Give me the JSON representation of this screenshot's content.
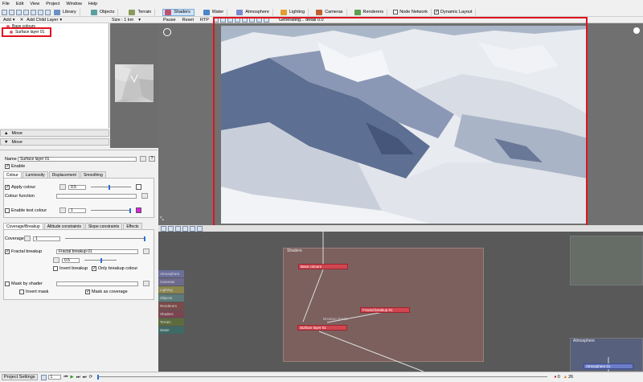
{
  "menu": [
    "File",
    "Edit",
    "View",
    "Project",
    "Window",
    "Help"
  ],
  "toolbar": {
    "buttons": [
      {
        "label": "Library",
        "color": "#6b8fc7"
      },
      {
        "label": "Objects",
        "color": "#5aa0a0"
      },
      {
        "label": "Terrain",
        "color": "#8a9a5a"
      },
      {
        "label": "Shaders",
        "color": "#c05070"
      },
      {
        "label": "Water",
        "color": "#4a86c8"
      },
      {
        "label": "Atmosphere",
        "color": "#7a8ad0"
      },
      {
        "label": "Lighting",
        "color": "#e0a030"
      },
      {
        "label": "Cameras",
        "color": "#c06030"
      },
      {
        "label": "Renderers",
        "color": "#5aa050"
      }
    ],
    "node_network": "Node Network",
    "dynamic_layout": "Dynamic Layout"
  },
  "tree": {
    "add_label": "Add",
    "add_child_label": "Add Child Layer",
    "items": [
      "Base colours",
      "Surface layer 01"
    ],
    "move_up": "Move",
    "move_down": "Move"
  },
  "thumb": {
    "size_label": "Size : 1 km"
  },
  "settings": {
    "name_label": "Name",
    "name_value": "Surface layer 01",
    "enable_label": "Enable",
    "tabs": [
      "Colour",
      "Luminosity",
      "Displacement",
      "Smoothing"
    ],
    "apply_colour": "Apply colour",
    "apply_value": "0.5",
    "colour_function": "Colour function",
    "enable_test_colour": "Enable test colour",
    "test_value": "1",
    "coverage_tabs": [
      "Coverage/Breakup",
      "Altitude constraints",
      "Slope constraints",
      "Effects"
    ],
    "coverage_label": "Coverage",
    "coverage_value": "1",
    "fractal_breakup": "Fractal breakup",
    "fractal_value": "Fractal breakup 01",
    "fractal_num": "0.5",
    "invert_breakup": "Invert breakup",
    "only_breakup_colour": "Only breakup colour",
    "mask_by_shader": "Mask by shader",
    "invert_mask": "Invert mask",
    "mask_as_coverage": "Mask as coverage",
    "colors": {
      "test_swatch": "#e020e0",
      "apply_swatch": "#ffffff"
    }
  },
  "viewport": {
    "pause": "Pause",
    "reset": "Reset",
    "rtp": "RTP",
    "status": "Generating... detail 0.0"
  },
  "network": {
    "shaders_title": "Shaders",
    "atmosphere_title": "Atmosphere",
    "nodes": {
      "base_colours": "Base colours",
      "fractal": "Fractal breakup 01",
      "surface": "Surface layer 01",
      "atmosphere": "Atmosphere 01",
      "edge_label": "Breakup shader"
    },
    "legend": [
      {
        "label": "Atmosphere",
        "color": "#6a6f9c"
      },
      {
        "label": "Cameras",
        "color": "#6d6a8e"
      },
      {
        "label": "Lighting",
        "color": "#8a8450"
      },
      {
        "label": "Objects",
        "color": "#5d7a7a"
      },
      {
        "label": "Renderers",
        "color": "#7a4a48"
      },
      {
        "label": "Shaders",
        "color": "#7a4450"
      },
      {
        "label": "Terrain",
        "color": "#5c6b3c"
      },
      {
        "label": "Water",
        "color": "#3e6a66"
      }
    ]
  },
  "status": {
    "project_settings": "Project Settings",
    "frame": "1",
    "errors": "0",
    "warnings": "26"
  }
}
